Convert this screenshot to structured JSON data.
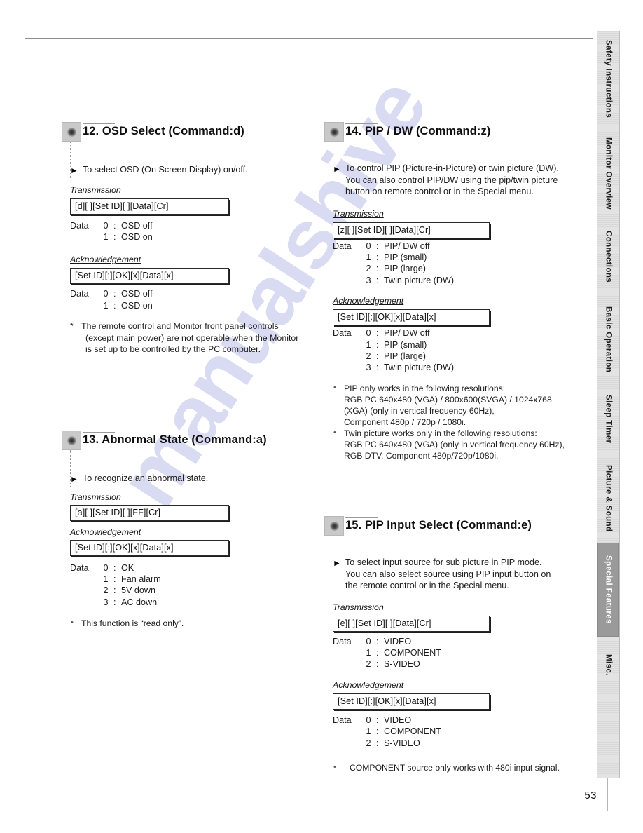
{
  "page": {
    "number": "53"
  },
  "tabs": [
    {
      "label": "Safety Instructions",
      "active": false,
      "height": 138
    },
    {
      "label": "Monitor Overview",
      "active": false,
      "height": 130
    },
    {
      "label": "Connections",
      "active": false,
      "height": 108
    },
    {
      "label": "Basic Operation",
      "active": false,
      "height": 128
    },
    {
      "label": "Sleep Timer",
      "active": false,
      "height": 100
    },
    {
      "label": "Picture & Sound",
      "active": false,
      "height": 126
    },
    {
      "label": "Special Features",
      "active": true,
      "height": 134
    },
    {
      "label": "Misc.",
      "active": false,
      "height": 80
    }
  ],
  "icons": {
    "section_marker": "star-burst-icon",
    "bullet": "triangle-right-icon",
    "note": "asterisk-icon"
  },
  "labels": {
    "transmission": "Transmission",
    "acknowledgement": "Acknowledgement",
    "data": "Data"
  },
  "sections": {
    "osd_select": {
      "title": "12. OSD Select (Command:d)",
      "intro": "To select OSD (On Screen Display) on/off.",
      "transmission_format": "[d][ ][Set ID][ ][Data][Cr]",
      "transmission_data": [
        {
          "key": "0",
          "value": "OSD off"
        },
        {
          "key": "1",
          "value": "OSD on"
        }
      ],
      "acknowledgement_format": "[Set ID][:][OK][x][Data][x]",
      "acknowledgement_data": [
        {
          "key": "0",
          "value": "OSD off"
        },
        {
          "key": "1",
          "value": "OSD on"
        }
      ],
      "note_line1": "The remote control and Monitor front panel controls",
      "note_line2": "(except main power) are not operable when the Monitor",
      "note_line3": "is set up to be controlled by the PC computer."
    },
    "abnormal_state": {
      "title": "13. Abnormal State (Command:a)",
      "intro": "To recognize an abnormal state.",
      "transmission_format": "[a][ ][Set ID][ ][FF][Cr]",
      "acknowledgement_format": "[Set ID][:][OK][x][Data][x]",
      "acknowledgement_data": [
        {
          "key": "0",
          "value": "OK"
        },
        {
          "key": "1",
          "value": "Fan alarm"
        },
        {
          "key": "2",
          "value": "5V down"
        },
        {
          "key": "3",
          "value": "AC down"
        }
      ],
      "note_line1": "This function is “read only”."
    },
    "pip_dw": {
      "title": "14. PIP / DW (Command:z)",
      "intro_line1": "To control PIP (Picture-in-Picture) or twin picture (DW).",
      "intro_line2": "You can also control PIP/DW using the pip/twin picture",
      "intro_line3": "button on remote control or in the Special menu.",
      "transmission_format": "[z][ ][Set ID][ ][Data][Cr]",
      "transmission_data": [
        {
          "key": "0",
          "value": "PIP/ DW off"
        },
        {
          "key": "1",
          "value": "PIP (small)"
        },
        {
          "key": "2",
          "value": "PIP (large)"
        },
        {
          "key": "3",
          "value": "Twin picture (DW)"
        }
      ],
      "acknowledgement_format": "[Set ID][:][OK][x][Data][x]",
      "acknowledgement_data": [
        {
          "key": "0",
          "value": "PIP/ DW off"
        },
        {
          "key": "1",
          "value": "PIP (small)"
        },
        {
          "key": "2",
          "value": "PIP (large)"
        },
        {
          "key": "3",
          "value": "Twin picture (DW)"
        }
      ],
      "note1_line1": "PIP only works in the following resolutions:",
      "note1_line2": "RGB PC 640x480 (VGA) / 800x600(SVGA) / 1024x768",
      "note1_line3": "(XGA) (only in vertical frequency 60Hz),",
      "note1_line4": "Component 480p / 720p / 1080i.",
      "note2_line1": "Twin picture works only in the following resolutions:",
      "note2_line2": "RGB PC 640x480 (VGA) (only in vertical frequency 60Hz),",
      "note2_line3": "RGB DTV, Component 480p/720p/1080i."
    },
    "pip_input_select": {
      "title": "15. PIP Input Select (Command:e)",
      "intro_line1": "To select input source for sub picture in PIP mode.",
      "intro_line2": "You can also select source using PIP input button on",
      "intro_line3": "the remote control or in the Special menu.",
      "transmission_format": "[e][ ][Set ID][ ][Data][Cr]",
      "transmission_data": [
        {
          "key": "0",
          "value": "VIDEO"
        },
        {
          "key": "1",
          "value": "COMPONENT"
        },
        {
          "key": "2",
          "value": "S-VIDEO"
        }
      ],
      "acknowledgement_format": "[Set ID][:][OK][x][Data][x]",
      "acknowledgement_data": [
        {
          "key": "0",
          "value": "VIDEO"
        },
        {
          "key": "1",
          "value": "COMPONENT"
        },
        {
          "key": "2",
          "value": "S-VIDEO"
        }
      ],
      "note_line1": "COMPONENT source only works with 480i input signal."
    }
  },
  "watermark": {
    "text": "manualshive"
  },
  "colors": {
    "tab_inactive_bg": "#e3e3e3",
    "tab_active_bg": "#9a9a9a",
    "watermark": "#ccd0ee",
    "text": "#1a1a1a"
  }
}
